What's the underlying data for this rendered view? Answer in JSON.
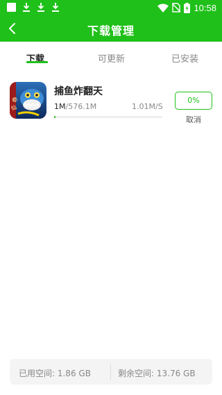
{
  "status_bar": {
    "time": "10:58",
    "icons": [
      "notification-square-icon",
      "download-icon",
      "download-icon",
      "download-icon",
      "wifi-icon",
      "no-sim-icon",
      "battery-charging-icon"
    ]
  },
  "header": {
    "title": "下载管理",
    "back_icon": "chevron-left-icon"
  },
  "tabs": [
    {
      "label": "下载",
      "active": true
    },
    {
      "label": "可更新",
      "active": false
    },
    {
      "label": "已安装",
      "active": false
    }
  ],
  "downloads": [
    {
      "name": "捕鱼炸翻天",
      "downloaded": "1M",
      "total": "/576.1M",
      "speed": "1.01M/S",
      "percent_label": "0%",
      "progress": 0.01,
      "cancel_label": "取消"
    }
  ],
  "storage": {
    "used": "已用空间: 1.86 GB",
    "free": "剩余空间: 13.76 GB"
  },
  "colors": {
    "accent": "#1fc01a",
    "background": "#ffffff",
    "muted_text": "#888888"
  }
}
